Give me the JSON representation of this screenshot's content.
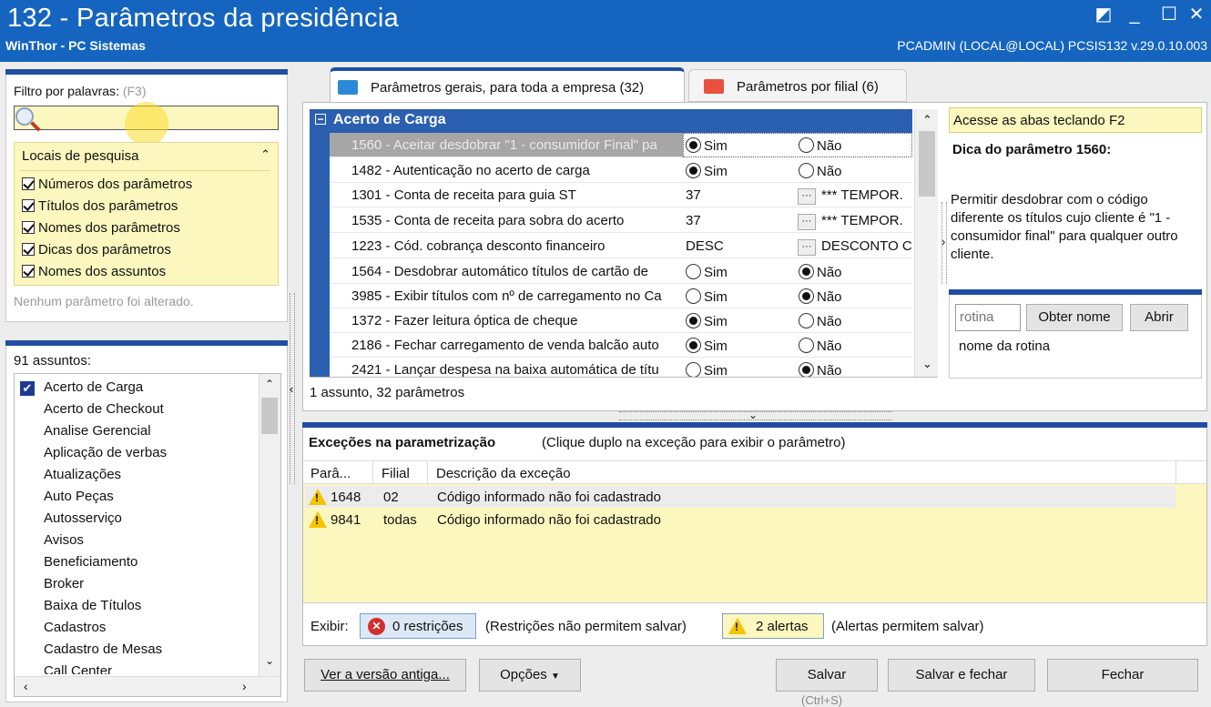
{
  "window": {
    "title": "132 - Parâmetros da presidência",
    "subtitle": "WinThor - PC Sistemas",
    "status": "PCADMIN (LOCAL@LOCAL)   PCSIS132  v.29.0.10.003"
  },
  "filter": {
    "label": "Filtro por palavras:",
    "shortcut": "(F3)",
    "value": "",
    "search_locations_title": "Locais de pesquisa",
    "options": [
      "Números dos parâmetros",
      "Títulos dos parâmetros",
      "Nomes dos parâmetros",
      "Dicas dos parâmetros",
      "Nomes dos assuntos"
    ],
    "no_change_text": "Nenhum parâmetro foi alterado."
  },
  "subjects": {
    "count_label": "91 assuntos:",
    "items": [
      "Acerto de Carga",
      "Acerto de Checkout",
      "Analise Gerencial",
      "Aplicação de verbas",
      "Atualizações",
      "Auto Peças",
      "Autosserviço",
      "Avisos",
      "Beneficiamento",
      "Broker",
      "Baixa de Títulos",
      "Cadastros",
      "Cadastro de Mesas",
      "Call Center"
    ]
  },
  "tabs": [
    {
      "label": "Parâmetros gerais, para toda a empresa (32)"
    },
    {
      "label": "Parâmetros por filial (6)"
    }
  ],
  "group": {
    "title": "Acerto de Carga"
  },
  "params": [
    {
      "name": "1560 - Aceitar desdobrar \"1 - consumidor Final\" pa",
      "type": "radio",
      "sim": true
    },
    {
      "name": "1482 - Autenticação no acerto de carga",
      "type": "radio",
      "sim": true
    },
    {
      "name": "1301 - Conta de receita para guia ST",
      "type": "lookup",
      "value": "37",
      "desc": "*** TEMPOR."
    },
    {
      "name": "1535 - Conta de receita para sobra do acerto",
      "type": "lookup",
      "value": "37",
      "desc": "*** TEMPOR."
    },
    {
      "name": "1223 - Cód. cobrança desconto financeiro",
      "type": "lookup",
      "value": "DESC",
      "desc": "DESCONTO C"
    },
    {
      "name": "1564 - Desdobrar automático títulos de cartão de",
      "type": "radio",
      "sim": false
    },
    {
      "name": "3985 - Exibir títulos com nº de carregamento no Ca",
      "type": "radio",
      "sim": false
    },
    {
      "name": "1372 - Fazer leitura óptica de cheque",
      "type": "radio",
      "sim": true
    },
    {
      "name": "2186 - Fechar carregamento de venda balcão auto",
      "type": "radio",
      "sim": true
    },
    {
      "name": "2421 - Lançar despesa na baixa automática de títu",
      "type": "radio",
      "sim": false
    }
  ],
  "radio_labels": {
    "yes": "Sim",
    "no": "Não"
  },
  "table_footer": "1 assunto, 32 parâmetros",
  "tip": {
    "hint": "Acesse as abas teclando F2",
    "title": "Dica do parâmetro 1560:",
    "body": "Permitir desdobrar com o código diferente os títulos cujo cliente é \"1 - consumidor final\" para qualquer outro cliente."
  },
  "routine": {
    "placeholder": "rotina",
    "get_name_label": "Obter nome",
    "open_label": "Abrir",
    "name_text": "nome da rotina"
  },
  "exceptions": {
    "title": "Exceções na parametrização",
    "subtitle": "(Clique duplo na exceção para exibir o parâmetro)",
    "columns": [
      "Parâ...",
      "Filial",
      "Descrição da exceção"
    ],
    "rows": [
      {
        "param": "1648",
        "filial": "02",
        "desc": "Código informado não foi cadastrado"
      },
      {
        "param": "9841",
        "filial": "todas",
        "desc": "Código informado não foi cadastrado"
      }
    ],
    "show_label": "Exibir:",
    "restrictions_btn": "0 restrições",
    "restrictions_note": "(Restrições não permitem salvar)",
    "alerts_btn": "2 alertas",
    "alerts_note": "(Alertas permitem salvar)"
  },
  "footer": {
    "old_version": "Ver a versão antiga...",
    "options": "Opções",
    "save": "Salvar",
    "save_hint": "(Ctrl+S)",
    "save_close": "Salvar e fechar",
    "close": "Fechar"
  },
  "colors": {
    "titlebar": "#1565c0",
    "accent": "#1f4ea3",
    "yellow": "#fcf7bf",
    "selected_row": "#a6a6a6"
  }
}
